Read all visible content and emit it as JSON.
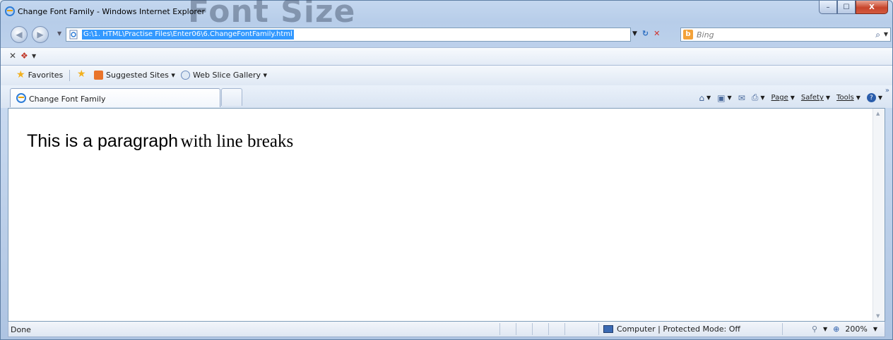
{
  "window": {
    "title": "Change Font Family - Windows Internet Explorer",
    "background_heading": "Font Size",
    "controls": {
      "minimize": "–",
      "maximize": "☐",
      "close": "X"
    }
  },
  "address_bar": {
    "url": "G:\\1. HTML\\Practise Files\\Enter06\\6.ChangeFontFamily.html"
  },
  "search": {
    "placeholder": "Bing",
    "logo_letter": "b"
  },
  "favorites_bar": {
    "favorites_label": "Favorites",
    "items": [
      {
        "label": "Suggested Sites ▾"
      },
      {
        "label": "Web Slice Gallery ▾"
      }
    ]
  },
  "tabs": [
    {
      "label": "Change Font Family"
    }
  ],
  "command_bar": {
    "page_label": "Page",
    "safety_label": "Safety",
    "tools_label": "Tools",
    "help_label": "?"
  },
  "content": {
    "paragraph_sans": "This is a paragraph",
    "paragraph_serif": "with line breaks"
  },
  "status_bar": {
    "status": "Done",
    "zone": "Computer | Protected Mode: Off",
    "zoom": "200%"
  },
  "colors": {
    "selection": "#3399ff",
    "close_button": "#c7452c"
  }
}
